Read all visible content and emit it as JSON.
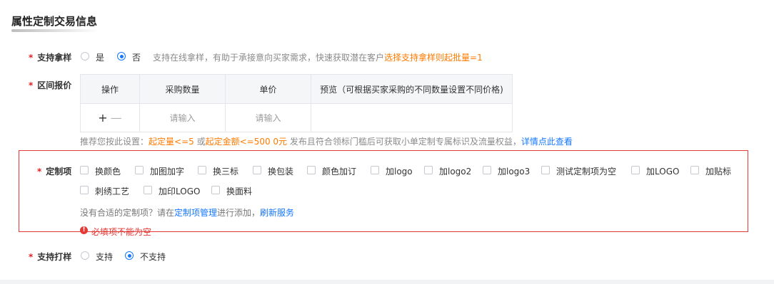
{
  "section_title": "属性定制交易信息",
  "sample": {
    "required_mark": "*",
    "label": "支持拿样",
    "options": [
      "是",
      "否"
    ],
    "selected": "否",
    "hint_prefix": "支持在线拿样，有助于承接意向买家需求，快速获取潜在客户",
    "hint_highlight": "选择支持拿样则起批量=1"
  },
  "range_price": {
    "required_mark": "*",
    "label": "区间报价",
    "columns": [
      "操作",
      "采购数量",
      "单价",
      "预览（可根据买家采购的不同数量设置不同价格)"
    ],
    "row": {
      "add_icon": "+",
      "remove_icon": "—",
      "quantity_placeholder": "请输入",
      "price_placeholder": "请输入"
    },
    "suggest": {
      "prefix": "推荐您按此设置：",
      "min_qty": "起定量<=5",
      "or_text": " 或",
      "min_amount": "起定金额<=500 0元",
      "middle": " 发布且符合领标门槛后可获取小单定制专属标识及流量权益，",
      "link": "详情点此查看"
    }
  },
  "customization": {
    "required_mark": "*",
    "label": "定制项",
    "items_row1": [
      "换颜色",
      "加图加字",
      "换三标",
      "换包装",
      "颜色加订",
      "加logo",
      "加logo2",
      "加logo3",
      "测试定制项为空",
      "加LOGO",
      "加贴标"
    ],
    "items_row2": [
      "刺绣工艺",
      "加印LOGO",
      "换面料"
    ],
    "no_fit_prefix": "没有合适的定制项？请在",
    "manage_link": "定制项管理",
    "no_fit_middle": "进行添加，",
    "refresh_link": "刷新服务",
    "error_icon": "!",
    "error_text": "必填项不能为空",
    "error_color": "#e53935"
  },
  "proofing": {
    "required_mark": "*",
    "label": "支持打样",
    "options": [
      "支持",
      "不支持"
    ],
    "selected": "不支持"
  },
  "colors": {
    "accent": "#1677ff",
    "highlight": "#ff7a00",
    "required": "#e02020"
  }
}
